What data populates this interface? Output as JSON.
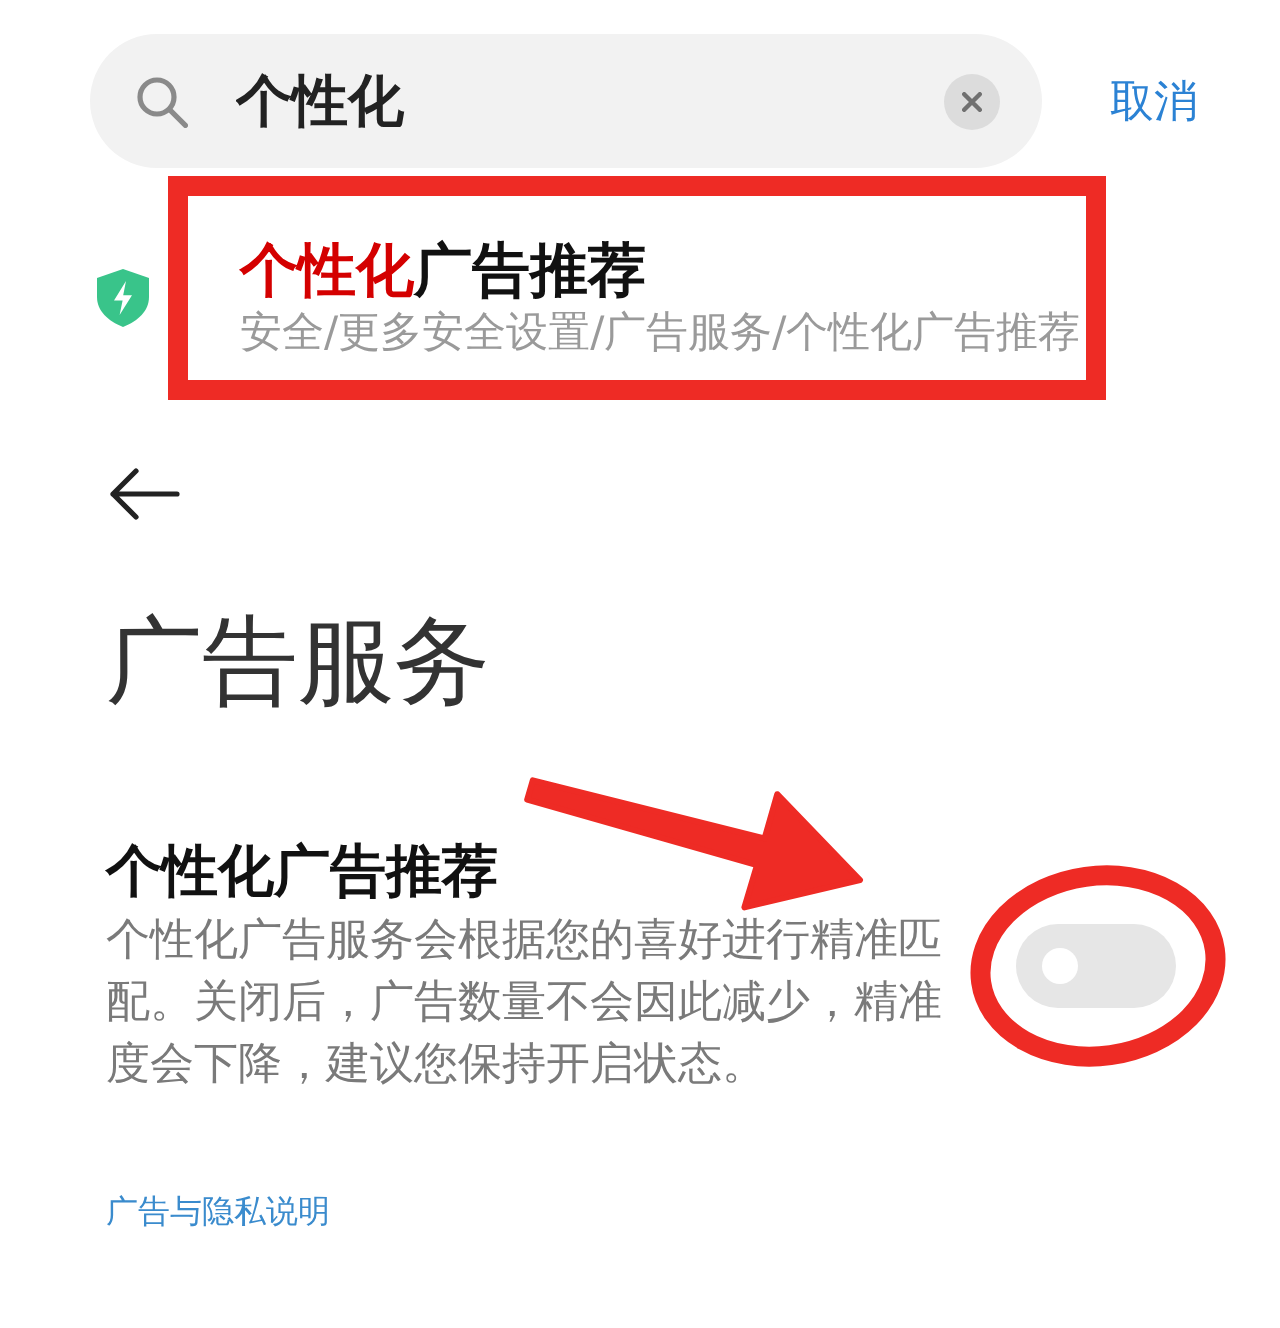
{
  "search": {
    "query": "个性化",
    "cancel": "取消"
  },
  "results": [
    {
      "title": "**个性化**广告推荐",
      "path": "安全/更多安全设置/广告服务/个性化广告推荐"
    }
  ],
  "page": {
    "title": "广告服务"
  },
  "settings": [
    {
      "title": "个性化广告推荐",
      "description": "个性化广告服务会根据您的喜好进行精准匹配。关闭后，广告数量不会因此减少，精准度会下降，建议您保持开启状态。",
      "on": false
    }
  ],
  "links": [
    "广告与隐私说明"
  ],
  "annotations": [
    {
      "kind": "frame"
    },
    {
      "kind": "arrow"
    },
    {
      "kind": "circle"
    }
  ]
}
